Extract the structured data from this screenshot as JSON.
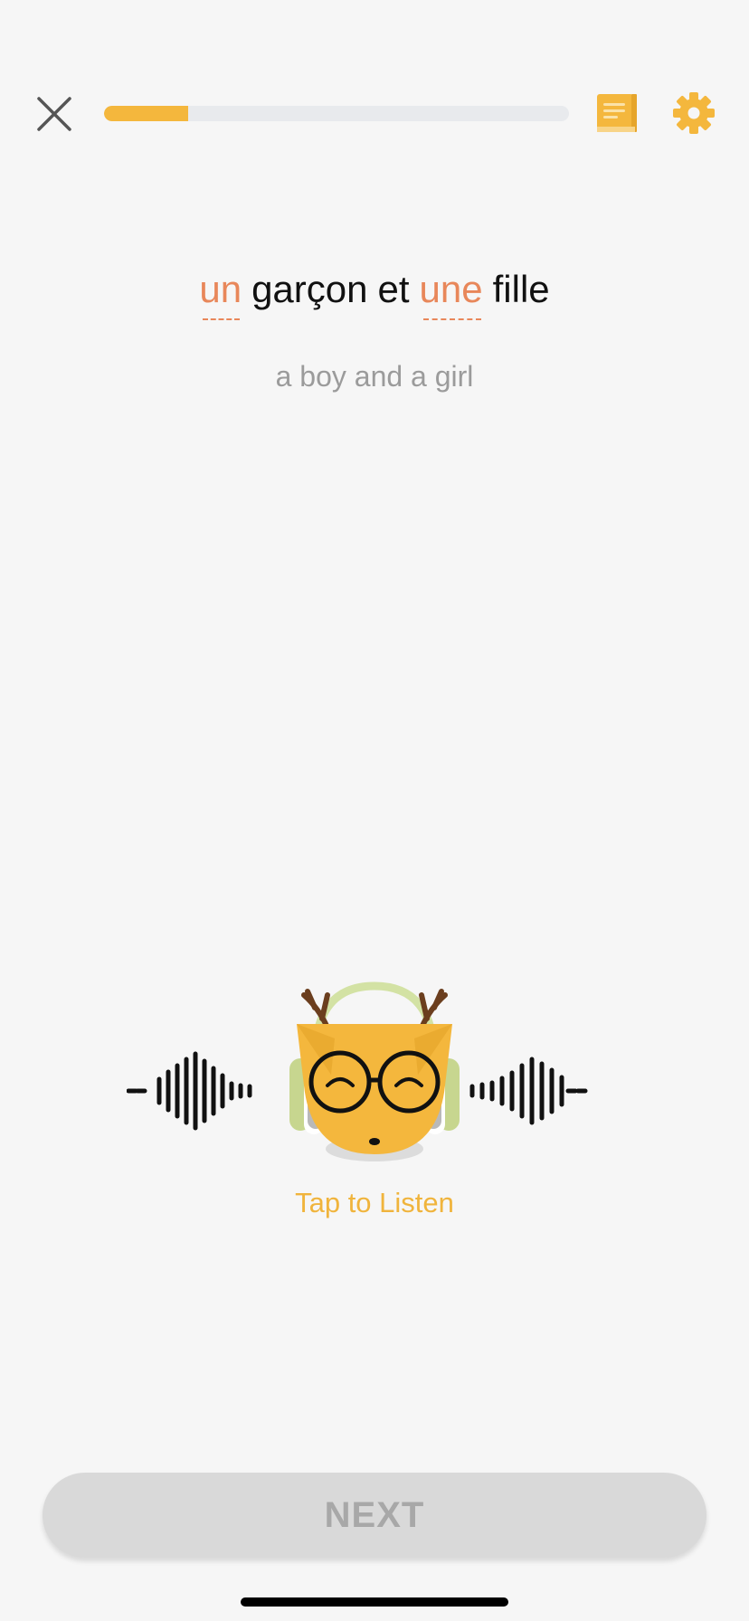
{
  "header": {
    "close_icon": "close-icon",
    "progress": 0.18,
    "notes_icon": "notes-book-icon",
    "settings_icon": "gear-icon",
    "accent_color": "#f4b73d"
  },
  "sentence": {
    "words": [
      {
        "text": "un",
        "highlighted": true
      },
      {
        "text": "garçon",
        "highlighted": false
      },
      {
        "text": "et",
        "highlighted": false
      },
      {
        "text": "une",
        "highlighted": true
      },
      {
        "text": "fille",
        "highlighted": false
      }
    ],
    "highlight_color": "#e8875a",
    "translation": "a boy and a girl"
  },
  "listen": {
    "label": "Tap to Listen",
    "mascot_icon": "deer-headphones-mascot-icon",
    "waveform_icon": "sound-wave-icon"
  },
  "footer": {
    "next_label": "NEXT"
  }
}
